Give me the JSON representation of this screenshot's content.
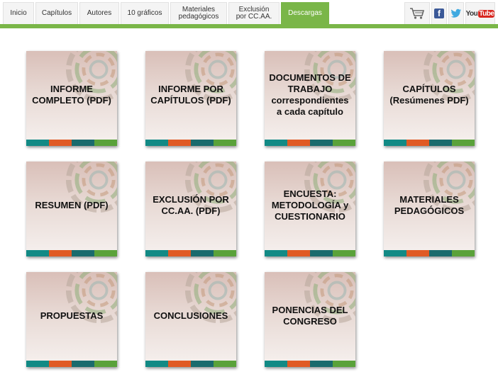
{
  "nav": {
    "items": [
      {
        "label": "Inicio",
        "active": false
      },
      {
        "label": "Capítulos",
        "active": false
      },
      {
        "label": "Autores",
        "active": false
      },
      {
        "label": "10 gráficos",
        "active": false
      },
      {
        "label": "Materiales\npedagógicos",
        "active": false
      },
      {
        "label": "Exclusión\npor CC.AA.",
        "active": false
      },
      {
        "label": "Descargas",
        "active": true
      }
    ]
  },
  "social": {
    "cart_icon": "shopping-cart-icon",
    "facebook": "f",
    "twitter_icon": "twitter-bird-icon",
    "youtube_you": "You",
    "youtube_tube": "Tube"
  },
  "tiles": [
    {
      "label": "INFORME\nCOMPLETO (PDF)"
    },
    {
      "label": "INFORME POR\nCAPÍTULOS (PDF)"
    },
    {
      "label": "DOCUMENTOS DE\nTRABAJO\ncorrespondientes\na cada capítulo"
    },
    {
      "label": "CAPÍTULOS\n(Resúmenes PDF)"
    },
    {
      "label": "RESUMEN (PDF)"
    },
    {
      "label": "EXCLUSIÓN POR\nCC.AA. (PDF)"
    },
    {
      "label": "ENCUESTA:\nMETODOLOGÍA y\nCUESTIONARIO"
    },
    {
      "label": "MATERIALES\nPEDAGÓGICOS"
    },
    {
      "label": "PROPUESTAS"
    },
    {
      "label": "CONCLUSIONES"
    },
    {
      "label": "PONENCIAS DEL\nCONGRESO"
    }
  ],
  "colors": {
    "accent_green": "#7ab648",
    "stripe": [
      "#128a85",
      "#e05a24",
      "#1a6b6d",
      "#5aa23a"
    ]
  }
}
